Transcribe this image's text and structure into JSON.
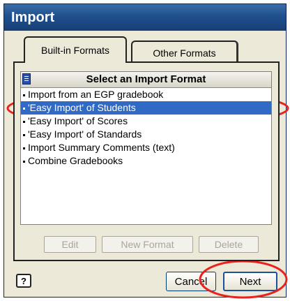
{
  "window": {
    "title": "Import"
  },
  "tabs": [
    {
      "label": "Built-in Formats",
      "active": true
    },
    {
      "label": "Other Formats",
      "active": false
    }
  ],
  "list": {
    "header": "Select an Import Format",
    "items": [
      {
        "label": "Import from an EGP gradebook",
        "selected": false
      },
      {
        "label": "'Easy Import' of Students",
        "selected": true
      },
      {
        "label": "'Easy Import' of Scores",
        "selected": false
      },
      {
        "label": "'Easy Import' of Standards",
        "selected": false
      },
      {
        "label": "Import Summary Comments (text)",
        "selected": false
      },
      {
        "label": "Combine Gradebooks",
        "selected": false
      }
    ]
  },
  "list_buttons": {
    "edit": "Edit",
    "new_format": "New Format",
    "delete": "Delete"
  },
  "footer": {
    "help": "?",
    "cancel": "Cancel",
    "next": "Next"
  },
  "colors": {
    "selection": "#316ac5",
    "annotation": "#e8231f",
    "titlebar": "#1f4f8e"
  }
}
